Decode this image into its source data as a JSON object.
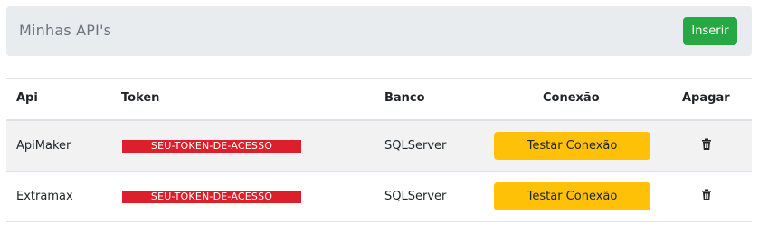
{
  "header": {
    "title": "Minhas API's",
    "insert_label": "Inserir"
  },
  "table": {
    "columns": {
      "api": "Api",
      "token": "Token",
      "banco": "Banco",
      "conexao": "Conexão",
      "apagar": "Apagar"
    },
    "rows": [
      {
        "api": "ApiMaker",
        "token": "SEU-TOKEN-DE-ACESSO",
        "banco": "SQLServer",
        "test_label": "Testar Conexão",
        "delete_icon": "trash-icon"
      },
      {
        "api": "Extramax",
        "token": "SEU-TOKEN-DE-ACESSO",
        "banco": "SQLServer",
        "test_label": "Testar Conexão",
        "delete_icon": "trash-icon"
      }
    ]
  },
  "colors": {
    "insert_button": "#28a745",
    "test_button": "#ffc107",
    "token_highlight": "#dc1f2a",
    "header_background": "#e9ecef"
  }
}
